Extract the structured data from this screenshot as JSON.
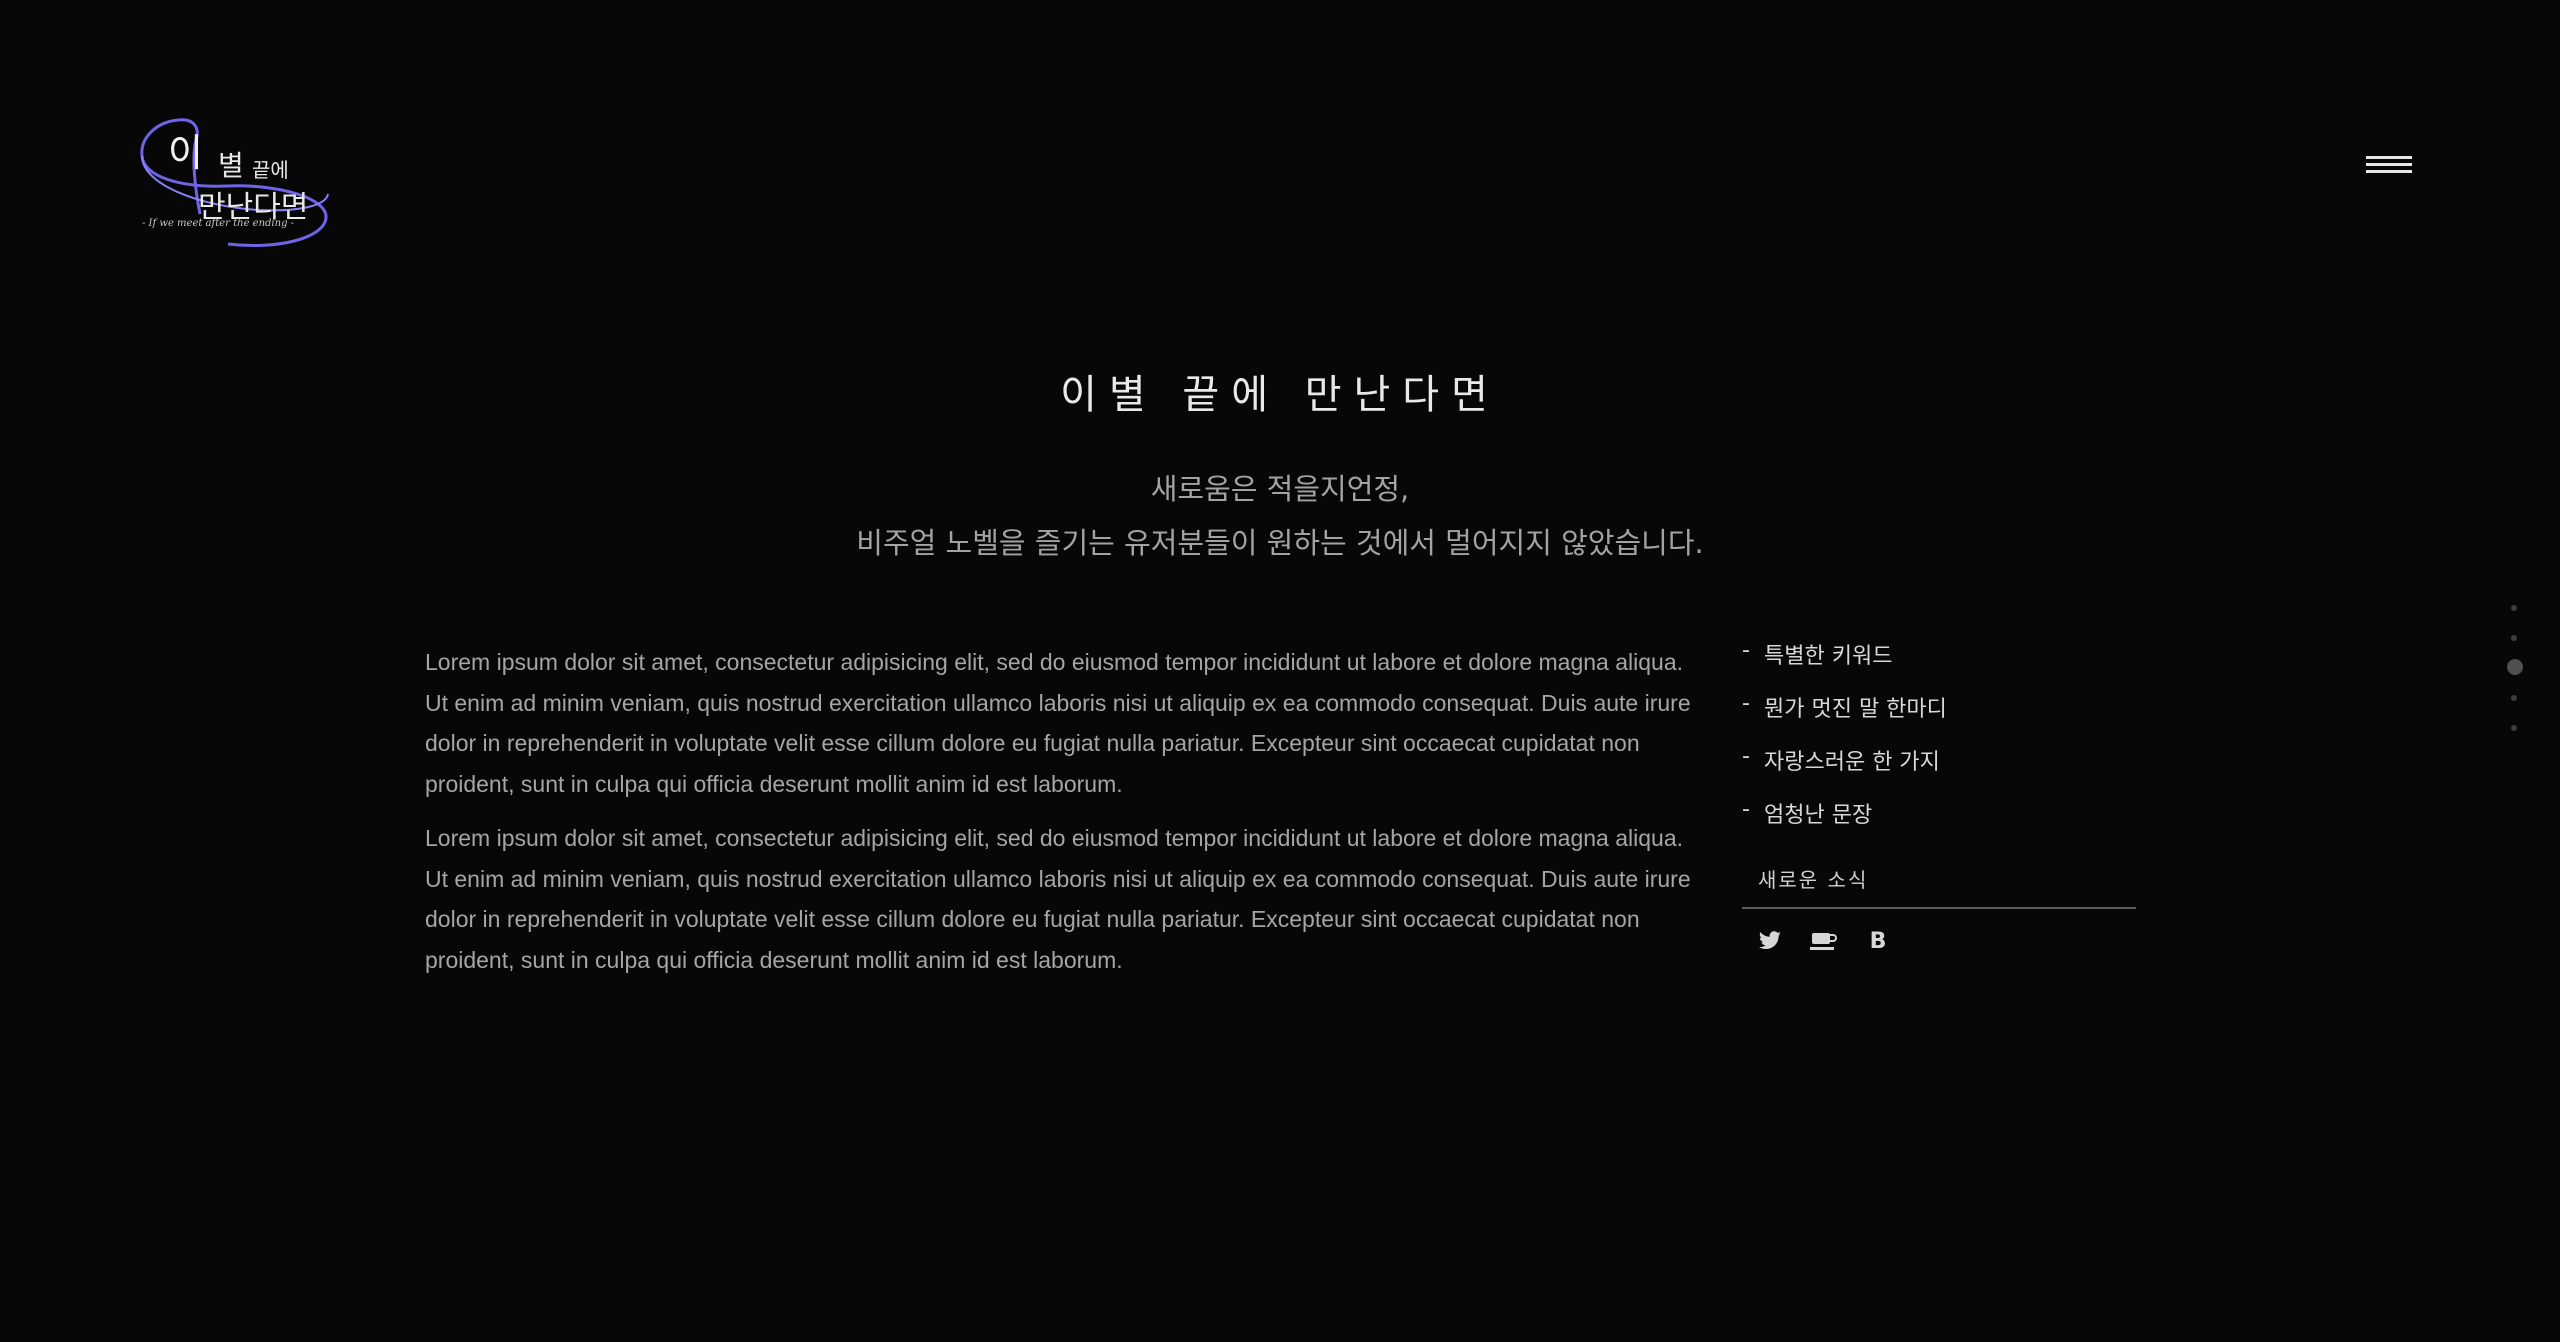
{
  "logo": {
    "line1_big": "이",
    "line1_rest": "별",
    "line1_small": "끝에",
    "line2": "만난다면",
    "tagline": "- If we meet after the ending -",
    "accent_color": "#6f63e8"
  },
  "header": {
    "menu_icon": "hamburger-icon"
  },
  "hero": {
    "title": "이별 끝에 만난다면",
    "subtitle_line1": "새로움은 적을지언정,",
    "subtitle_line2": "비주얼 노벨을 즐기는 유저분들이 원하는 것에서 멀어지지 않았습니다."
  },
  "content": {
    "paragraphs": [
      "Lorem ipsum dolor sit amet, consectetur adipisicing elit, sed do eiusmod tempor incididunt ut labore et dolore magna aliqua. Ut enim ad minim veniam, quis nostrud exercitation ullamco laboris nisi ut aliquip ex ea commodo consequat. Duis aute irure dolor in reprehenderit in voluptate velit esse cillum dolore eu fugiat nulla pariatur. Excepteur sint occaecat cupidatat non proident, sunt in culpa qui officia deserunt mollit anim id est laborum.",
      "Lorem ipsum dolor sit amet, consectetur adipisicing elit, sed do eiusmod tempor incididunt ut labore et dolore magna aliqua. Ut enim ad minim veniam, quis nostrud exercitation ullamco laboris nisi ut aliquip ex ea commodo consequat. Duis aute irure dolor in reprehenderit in voluptate velit esse cillum dolore eu fugiat nulla pariatur. Excepteur sint occaecat cupidatat non proident, sunt in culpa qui officia deserunt mollit anim id est laborum."
    ]
  },
  "sidebar": {
    "items": [
      {
        "dash": "-",
        "label": "특별한 키워드"
      },
      {
        "dash": "-",
        "label": "뭔가 멋진 말 한마디"
      },
      {
        "dash": "-",
        "label": "자랑스러운 한 가지"
      },
      {
        "dash": "-",
        "label": "엄청난 문장"
      }
    ],
    "news_label": "새로운 소식",
    "social": [
      {
        "icon": "twitter-icon"
      },
      {
        "icon": "coffee-cup-icon"
      },
      {
        "icon": "blog-b-icon",
        "text": "B"
      }
    ]
  },
  "pagination": {
    "count": 5,
    "active_index": 2
  }
}
